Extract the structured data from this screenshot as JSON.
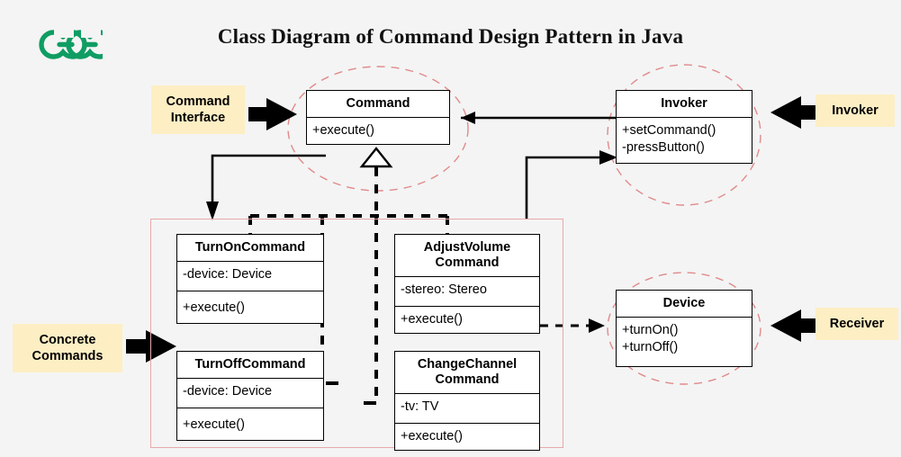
{
  "page": {
    "title": "Class Diagram of Command Design Pattern in Java",
    "background_color": "#f4f4f4",
    "logo_name": "geeksforgeeks-logo",
    "logo_color": "#0f9d63"
  },
  "tags": {
    "command_interface": "Command\nInterface",
    "command_interface_line1": "Command",
    "command_interface_line2": "Interface",
    "invoker": "Invoker",
    "concrete_commands_line1": "Concrete",
    "concrete_commands_line2": "Commands",
    "receiver": "Receiver",
    "background_color": "#fdeec4"
  },
  "classes": {
    "command": {
      "name": "Command",
      "attributes": [],
      "methods": [
        "+execute()"
      ]
    },
    "invoker": {
      "name": "Invoker",
      "attributes": [],
      "methods": [
        "+setCommand()",
        "-pressButton()"
      ]
    },
    "turn_on_command": {
      "name": "TurnOnCommand",
      "attributes": [
        "-device: Device"
      ],
      "methods": [
        "+execute()"
      ]
    },
    "turn_off_command": {
      "name": "TurnOffCommand",
      "attributes": [
        "-device: Device"
      ],
      "methods": [
        "+execute()"
      ]
    },
    "adjust_volume_command": {
      "name_line1": "AdjustVolume",
      "name_line2": "Command",
      "attributes": [
        "-stereo: Stereo"
      ],
      "methods": [
        "+execute()"
      ]
    },
    "change_channel_command": {
      "name_line1": "ChangeChannel",
      "name_line2": "Command",
      "attributes": [
        "-tv: TV"
      ],
      "methods": [
        "+execute()"
      ]
    },
    "device": {
      "name": "Device",
      "attributes": [],
      "methods": [
        "+turnOn()",
        "+turnOff()"
      ]
    }
  },
  "colors": {
    "ellipse_stroke": "#e08a8a",
    "frame_stroke": "#e7a9a9",
    "connector": "#000000",
    "box_fill": "#ffffff"
  }
}
